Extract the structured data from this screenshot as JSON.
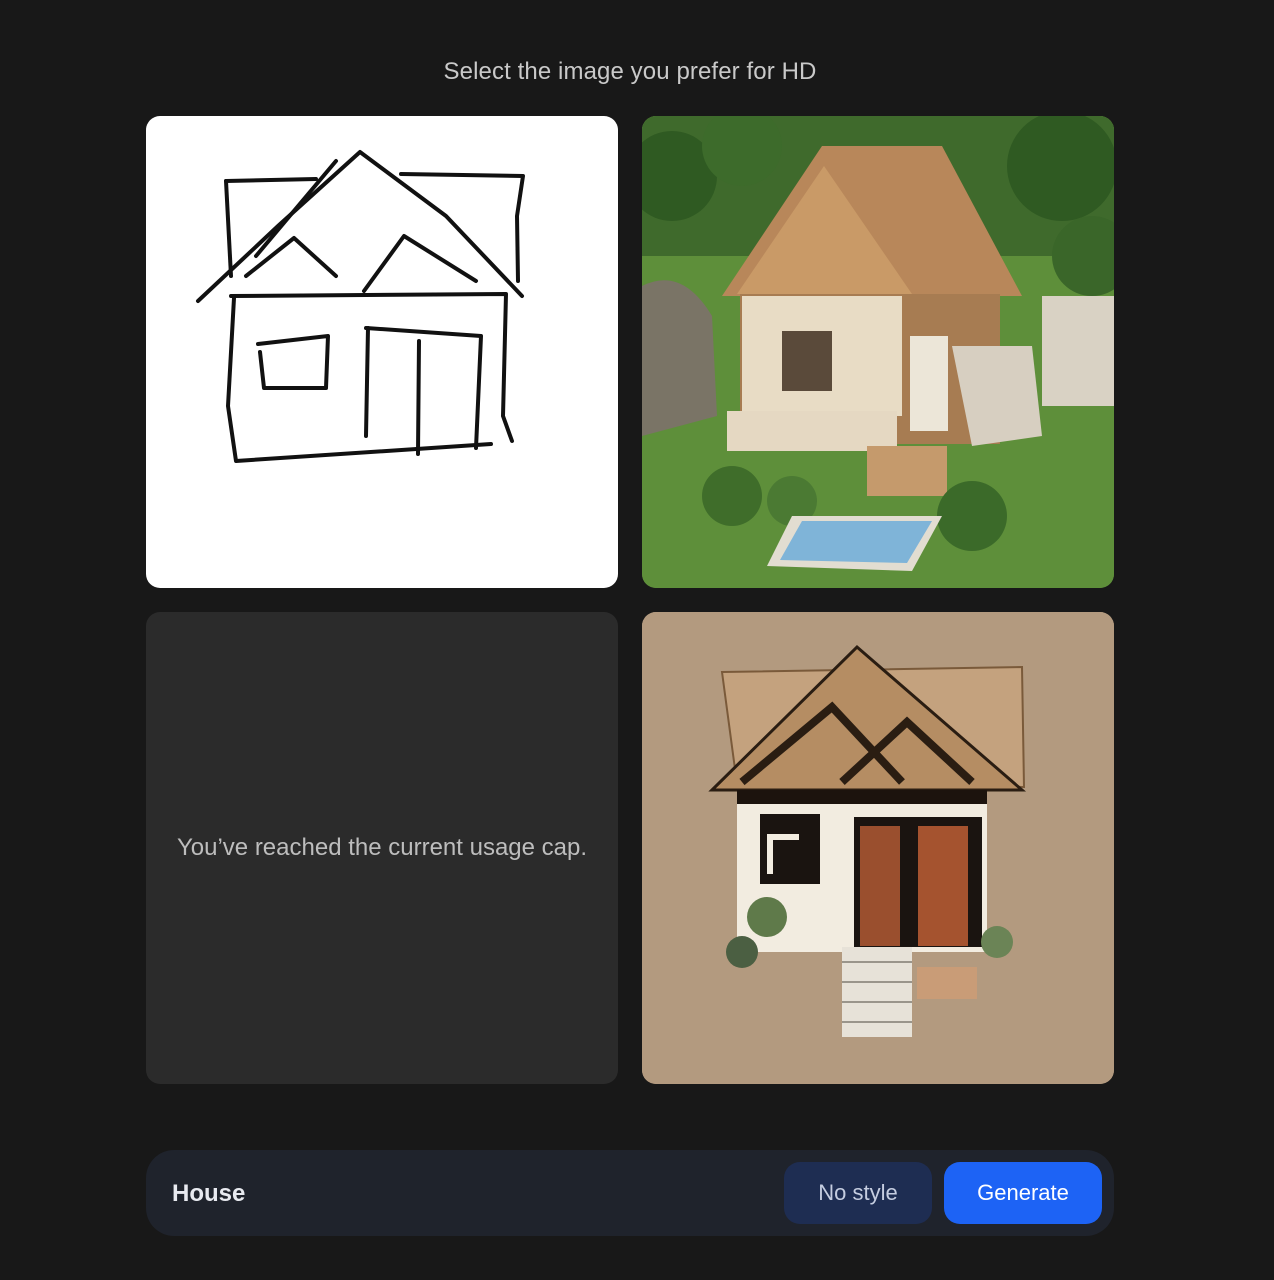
{
  "header": {
    "title": "Select the image you prefer for HD"
  },
  "results": {
    "usage_cap_message": "You’ve reached the current usage cap."
  },
  "prompt_bar": {
    "prompt_value": "House",
    "style_label": "No style",
    "generate_label": "Generate"
  },
  "colors": {
    "background": "#181818",
    "tile_empty": "#2b2b2b",
    "bar_background": "#1f232c",
    "style_button": "#1e2d52",
    "generate_button": "#1d63f5"
  }
}
